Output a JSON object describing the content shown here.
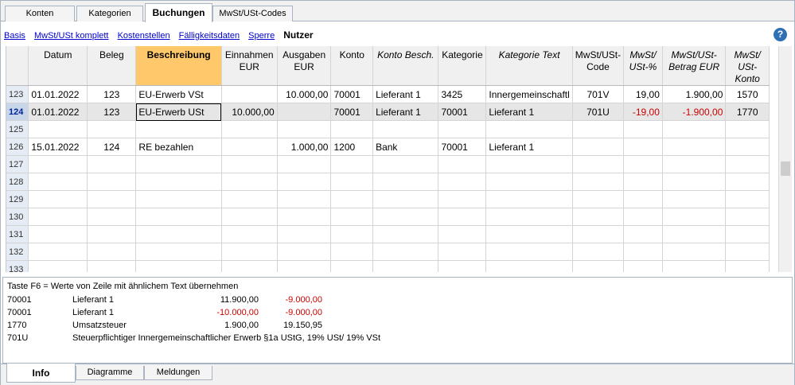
{
  "top_tabs": [
    "Konten",
    "Kategorien",
    "Buchungen",
    "MwSt/USt-Codes"
  ],
  "views": {
    "links": [
      "Basis",
      "MwSt/USt komplett",
      "Kostenstellen",
      "Fälligkeitsdaten",
      "Sperre"
    ],
    "active": "Nutzer"
  },
  "help_icon": "?",
  "columns": {
    "datum": "Datum",
    "beleg": "Beleg",
    "beschreibung": "Beschreibung",
    "einnahmen": "Einnahmen EUR",
    "ausgaben": "Ausgaben EUR",
    "konto": "Konto",
    "konto_besch": "Konto Besch.",
    "kategorie": "Kategorie",
    "kategorie_text": "Kategorie Text",
    "mwst_code": "MwSt/USt-Code",
    "mwst_pct": "MwSt/ USt-%",
    "mwst_betrag": "MwSt/USt-Betrag EUR",
    "mwst_konto": "MwSt/ USt-Konto"
  },
  "rows": [
    {
      "n": "123",
      "datum": "01.01.2022",
      "beleg": "123",
      "beschreibung": "EU-Erwerb VSt",
      "einnahmen": "",
      "ausgaben": "10.000,00",
      "konto": "70001",
      "konto_besch": "Lieferant 1",
      "kategorie": "3425",
      "kategorie_text": "Innergemeinschaftl",
      "mwst_code": "701V",
      "mwst_pct": "19,00",
      "mwst_betrag": "1.900,00",
      "mwst_konto": "1570"
    },
    {
      "n": "124",
      "datum": "01.01.2022",
      "beleg": "123",
      "beschreibung": "EU-Erwerb USt",
      "einnahmen": "10.000,00",
      "ausgaben": "",
      "konto": "70001",
      "konto_besch": "Lieferant 1",
      "kategorie": "70001",
      "kategorie_text": "Lieferant 1",
      "mwst_code": "701U",
      "mwst_pct": "-19,00",
      "mwst_betrag": "-1.900,00",
      "mwst_konto": "1770"
    },
    {
      "n": "125",
      "datum": "",
      "beleg": "",
      "beschreibung": "",
      "einnahmen": "",
      "ausgaben": "",
      "konto": "",
      "konto_besch": "",
      "kategorie": "",
      "kategorie_text": "",
      "mwst_code": "",
      "mwst_pct": "",
      "mwst_betrag": "",
      "mwst_konto": ""
    },
    {
      "n": "126",
      "datum": "15.01.2022",
      "beleg": "124",
      "beschreibung": "RE bezahlen",
      "einnahmen": "",
      "ausgaben": "1.000,00",
      "konto": "1200",
      "konto_besch": "Bank",
      "kategorie": "70001",
      "kategorie_text": "Lieferant 1",
      "mwst_code": "",
      "mwst_pct": "",
      "mwst_betrag": "",
      "mwst_konto": ""
    },
    {
      "n": "127"
    },
    {
      "n": "128"
    },
    {
      "n": "129"
    },
    {
      "n": "130"
    },
    {
      "n": "131"
    },
    {
      "n": "132"
    },
    {
      "n": "133"
    }
  ],
  "info": {
    "title": "Taste F6 = Werte von Zeile mit ähnlichem Text übernehmen",
    "lines": [
      {
        "a": "70001",
        "b": "Lieferant 1",
        "c": "11.900,00",
        "d": "-9.000,00"
      },
      {
        "a": "70001",
        "b": "Lieferant 1",
        "c": "-10.000,00",
        "d": "-9.000,00"
      },
      {
        "a": "1770",
        "b": "Umsatzsteuer",
        "c": "1.900,00",
        "d": "19.150,95"
      },
      {
        "a": "701U",
        "b": "Steuerpflichtiger Innergemeinschaftlicher Erwerb §1a UStG, 19% USt/ 19% VSt",
        "c": "",
        "d": ""
      }
    ]
  },
  "bottom_tabs": [
    "Info",
    "Diagramme",
    "Meldungen"
  ]
}
